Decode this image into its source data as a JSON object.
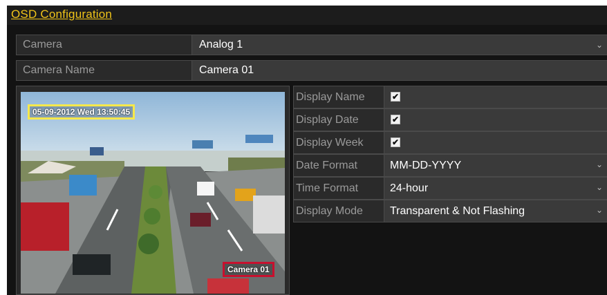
{
  "header": {
    "title": "OSD Configuration"
  },
  "camera": {
    "label": "Camera",
    "value": "Analog 1"
  },
  "camera_name": {
    "label": "Camera Name",
    "value": "Camera 01"
  },
  "preview": {
    "date_overlay": "05-09-2012 Wed 13:50:45",
    "name_overlay": "Camera 01"
  },
  "options": [
    {
      "label": "Display Name",
      "type": "checkbox",
      "checked": true,
      "mark": "✔"
    },
    {
      "label": "Display Date",
      "type": "checkbox",
      "checked": true,
      "mark": "✔"
    },
    {
      "label": "Display Week",
      "type": "checkbox",
      "checked": true,
      "mark": "✔"
    },
    {
      "label": "Date Format",
      "type": "dropdown",
      "value": "MM-DD-YYYY"
    },
    {
      "label": "Time Format",
      "type": "dropdown",
      "value": "24-hour"
    },
    {
      "label": "Display Mode",
      "type": "dropdown",
      "value": "Transparent & Not Flashing"
    }
  ],
  "colors": {
    "accent": "#f0c419",
    "date_box": "#f6e84a",
    "name_box": "#c8102e",
    "panel_bg": "#131313"
  }
}
